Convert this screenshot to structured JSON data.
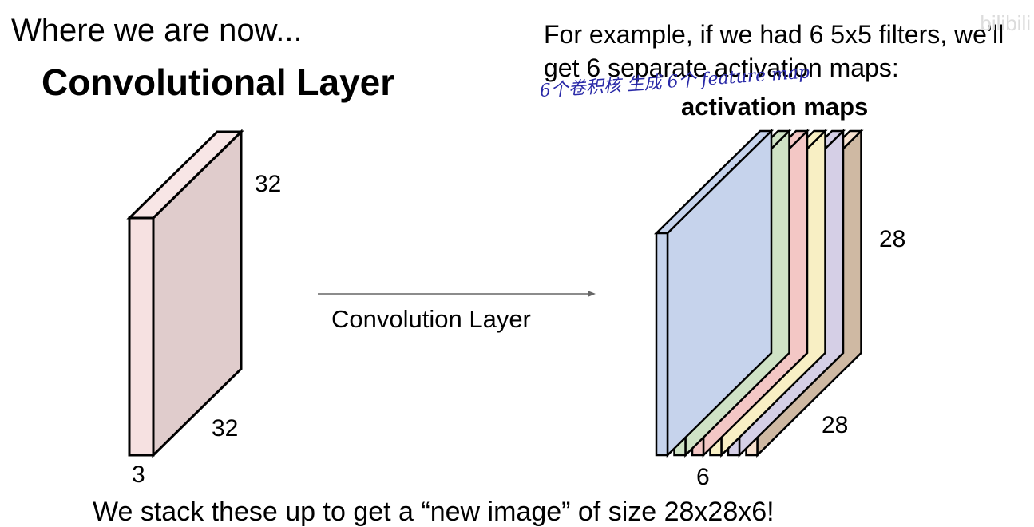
{
  "heading": "Where we are now...",
  "title": "Convolutional Layer",
  "example_text": [
    "For example, if we had 6 5x5 filters, we’ll",
    "get 6 separate activation maps:"
  ],
  "handwritten_note": "6个卷积核 生成 6个 feature map",
  "activation_title": "activation maps",
  "input_volume": {
    "height_label": "32",
    "width_label": "32",
    "depth_label": "3",
    "front_color": "#f6e1e1",
    "side_color": "#e0cccc",
    "top_color": "#f8e6e6"
  },
  "arrow_label": "Convolution Layer",
  "output_volume": {
    "height_label": "28",
    "width_label": "28",
    "depth_label": "6",
    "map_colors": [
      "#c6d3ec",
      "#cfe2c5",
      "#f3c7c5",
      "#f8efc4",
      "#d5cfe6",
      "#f7e1cf"
    ],
    "last_side_color": "#cfb9a3"
  },
  "bottom_text": "We stack these up to get a “new image” of size 28x28x6!",
  "watermark": "bilibili"
}
